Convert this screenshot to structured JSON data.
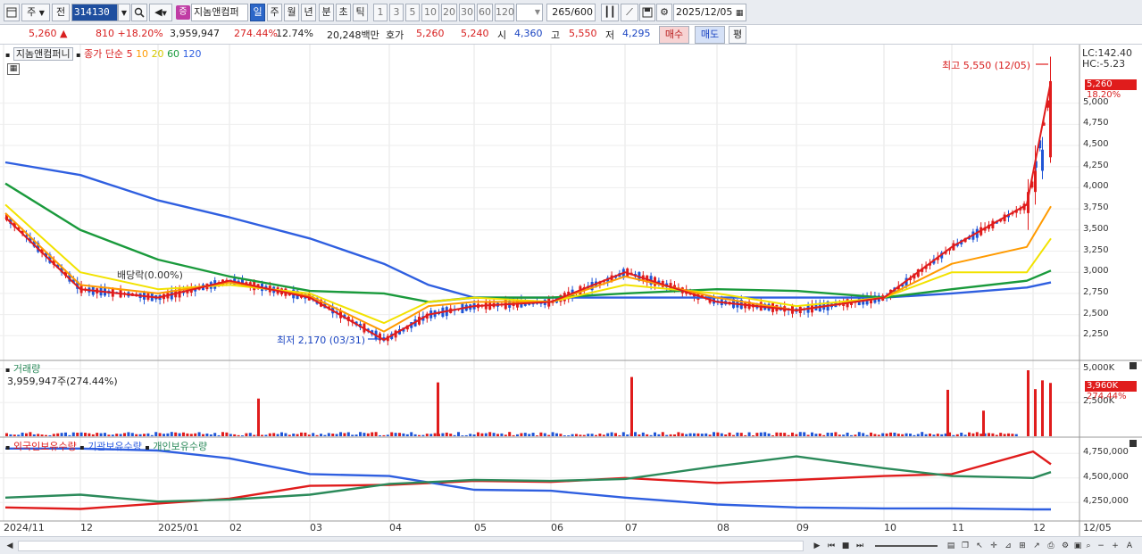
{
  "toolbar": {
    "menu_icon": "window-icon",
    "market": "주",
    "prev": "전",
    "code": "314130",
    "badge": "증",
    "name": "지놈앤컴퍼",
    "periods": [
      "일",
      "주",
      "월",
      "년",
      "분",
      "초",
      "틱"
    ],
    "intervals": [
      "1",
      "3",
      "5",
      "10",
      "20",
      "30",
      "60",
      "120"
    ],
    "count": "265",
    "count_total": "/600",
    "date": "2025/12/05"
  },
  "quote": {
    "price": "5,260",
    "arrow": "▲",
    "change": "810",
    "change_pct": "+18.20%",
    "volume": "3,959,947",
    "volume_pct": "274.44%",
    "turnover": "12.74%",
    "amount": "20,248백만",
    "ask_label": "호가",
    "ask": "5,260",
    "bid": "5,240",
    "open_label": "시",
    "open": "4,360",
    "high_label": "고",
    "high": "5,550",
    "low_label": "저",
    "low": "4,295",
    "buy": "매수",
    "sell": "매도",
    "avg": "평"
  },
  "price_panel": {
    "stock": "지놈앤컴퍼니",
    "ma_label": "종가 단순",
    "ma_periods": [
      "5",
      "10",
      "20",
      "60",
      "120"
    ],
    "lc": "LC:142.40",
    "hc": "HC:-5.23",
    "max_label": "최고 5,550 (12/05)",
    "min_label": "최저 2,170 (03/31)",
    "div_label": "배당락(0.00%)",
    "tag_price": "5,260",
    "tag_pct": "18.20%"
  },
  "volume_panel": {
    "title": "거래량",
    "value": "3,959,947주(274.44%)",
    "tag_value": "3,960K",
    "tag_pct": "274.44%"
  },
  "holdings_panel": {
    "series": [
      "외국인보유수량",
      "기관보유수량",
      "개인보유수량"
    ]
  },
  "colors": {
    "up": "#e01c1c",
    "down": "#1f55d6",
    "ma5": "#e01c1c",
    "ma10": "#ff9a00",
    "ma20": "#f2e200",
    "ma60": "#1a9a3c",
    "ma120": "#2f5fe0",
    "foreign": "#e01c1c",
    "institution": "#2f5fe0",
    "individual": "#2b8a5a"
  },
  "x_axis": [
    "2024/11",
    "12",
    "2025/01",
    "02",
    "03",
    "04",
    "05",
    "06",
    "07",
    "08",
    "09",
    "10",
    "11",
    "12",
    "12/05"
  ],
  "chart_data": [
    {
      "type": "line",
      "name": "price",
      "x": [
        "2024/11",
        "12",
        "2025/01",
        "02",
        "03",
        "03/31",
        "04",
        "05",
        "06",
        "07",
        "08",
        "09",
        "10",
        "11",
        "12",
        "12/05"
      ],
      "series": [
        {
          "name": "5",
          "values": [
            3650,
            2800,
            2700,
            2900,
            2700,
            2200,
            2500,
            2600,
            2650,
            3000,
            2650,
            2550,
            2700,
            3300,
            3800,
            5260
          ]
        },
        {
          "name": "10",
          "values": [
            3700,
            2850,
            2750,
            2880,
            2720,
            2300,
            2600,
            2650,
            2650,
            2950,
            2700,
            2550,
            2700,
            3100,
            3300,
            3780
          ]
        },
        {
          "name": "20",
          "values": [
            3800,
            3000,
            2800,
            2850,
            2750,
            2400,
            2650,
            2700,
            2650,
            2850,
            2750,
            2600,
            2700,
            3000,
            3000,
            3400
          ]
        },
        {
          "name": "60",
          "values": [
            4050,
            3500,
            3150,
            2950,
            2780,
            2750,
            2650,
            2700,
            2700,
            2750,
            2800,
            2780,
            2700,
            2800,
            2900,
            3020
          ]
        },
        {
          "name": "120",
          "values": [
            4300,
            4150,
            3850,
            3650,
            3400,
            3100,
            2850,
            2700,
            2700,
            2700,
            2700,
            2700,
            2700,
            2750,
            2820,
            2880
          ]
        }
      ],
      "y_ticks": [
        "5,000",
        "4,750",
        "4,500",
        "4,250",
        "4,000",
        "3,750",
        "3,500",
        "3,250",
        "3,000",
        "2,750",
        "2,500",
        "2,250"
      ],
      "ylim": [
        2000,
        5650
      ]
    },
    {
      "type": "bar",
      "name": "volume",
      "y_ticks": [
        "5,000K",
        "2,500K"
      ],
      "values_k": [
        3960,
        4150,
        3500,
        4900,
        1900,
        3450,
        4400,
        2800,
        4000,
        1000,
        1200,
        500,
        600
      ],
      "ylim_k": [
        0,
        5500
      ]
    },
    {
      "type": "line",
      "name": "holdings",
      "x": [
        "2024/11",
        "12",
        "2025/01",
        "02",
        "03",
        "04",
        "05",
        "06",
        "07",
        "08",
        "09",
        "10",
        "11",
        "12",
        "12/05"
      ],
      "series": [
        {
          "name": "외국인보유수량",
          "values": [
            4200000,
            4185000,
            4240000,
            4290000,
            4420000,
            4430000,
            4470000,
            4460000,
            4500000,
            4450000,
            4480000,
            4520000,
            4540000,
            4770000,
            4640000
          ]
        },
        {
          "name": "기관보유수량",
          "values": [
            4800000,
            4800000,
            4780000,
            4700000,
            4540000,
            4520000,
            4380000,
            4370000,
            4300000,
            4230000,
            4200000,
            4190000,
            4190000,
            4180000,
            4180000
          ]
        },
        {
          "name": "개인보유수량",
          "values": [
            4300000,
            4330000,
            4260000,
            4280000,
            4330000,
            4440000,
            4480000,
            4470000,
            4490000,
            4620000,
            4720000,
            4600000,
            4520000,
            4500000,
            4560000
          ]
        }
      ],
      "y_ticks": [
        "4,750,000",
        "4,500,000",
        "4,250,000"
      ],
      "ylim": [
        4080000,
        4880000
      ]
    }
  ]
}
